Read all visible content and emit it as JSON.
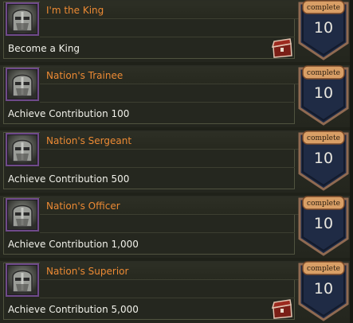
{
  "achievements": [
    {
      "title": "I'm the King",
      "description": "Become a King",
      "status_label": "complete",
      "count": "10",
      "avatar_icon": "knight-helmet-icon",
      "has_reward_chest": true
    },
    {
      "title": "Nation's Trainee",
      "description": "Achieve Contribution 100",
      "status_label": "complete",
      "count": "10",
      "avatar_icon": "knight-helmet-icon",
      "has_reward_chest": false
    },
    {
      "title": "Nation's Sergeant",
      "description": "Achieve Contribution 500",
      "status_label": "complete",
      "count": "10",
      "avatar_icon": "knight-helmet-icon",
      "has_reward_chest": false
    },
    {
      "title": "Nation's Officer",
      "description": "Achieve Contribution 1,000",
      "status_label": "complete",
      "count": "10",
      "avatar_icon": "knight-helmet-icon",
      "has_reward_chest": false
    },
    {
      "title": "Nation's Superior",
      "description": "Achieve Contribution 5,000",
      "status_label": "complete",
      "count": "10",
      "avatar_icon": "knight-helmet-icon",
      "has_reward_chest": true
    }
  ],
  "colors": {
    "title": "#ec8a34",
    "description": "#f1f1ea",
    "badge_fill": "#1f2b45",
    "badge_border": "#8f6a52",
    "tab_fill": "#d99f66"
  }
}
